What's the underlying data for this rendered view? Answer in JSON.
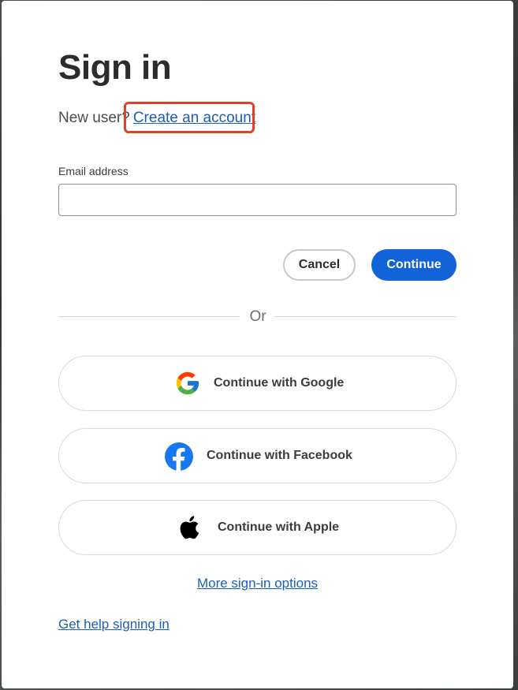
{
  "title": "Sign in",
  "new_user": {
    "prefix": "New user?",
    "link_label": "Create an account"
  },
  "email": {
    "label": "Email address",
    "value": "",
    "placeholder": ""
  },
  "actions": {
    "cancel_label": "Cancel",
    "continue_label": "Continue"
  },
  "divider_text": "Or",
  "social": [
    {
      "label": "Continue with Google",
      "icon": "google-icon"
    },
    {
      "label": "Continue with Facebook",
      "icon": "facebook-icon"
    },
    {
      "label": "Continue with Apple",
      "icon": "apple-icon"
    }
  ],
  "more_options_label": "More sign-in options",
  "help_label": "Get help signing in",
  "colors": {
    "primary": "#1262d9",
    "link": "#1b5fb5",
    "highlight": "#e0402a",
    "facebook": "#1877f2"
  }
}
